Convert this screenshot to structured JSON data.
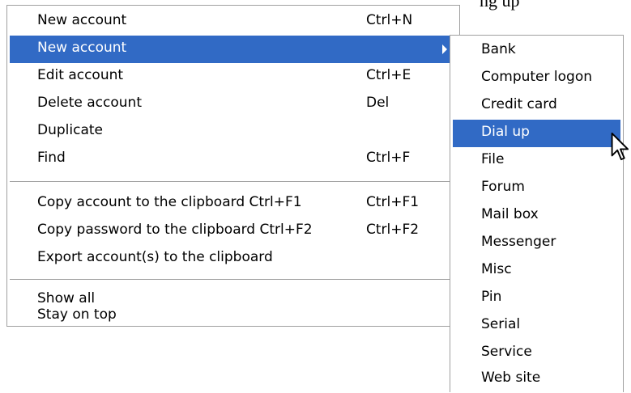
{
  "background_text": "ng up",
  "main_menu": {
    "items": [
      {
        "label": "New account",
        "shortcut": "Ctrl+N"
      },
      {
        "label": "New account",
        "shortcut": "",
        "submenu": true,
        "highlighted": true
      },
      {
        "label": "Edit account",
        "shortcut": "Ctrl+E"
      },
      {
        "label": "Delete account",
        "shortcut": "Del"
      },
      {
        "label": "Duplicate",
        "shortcut": ""
      },
      {
        "label": "Find",
        "shortcut": "Ctrl+F"
      },
      {
        "label": "Copy account to the clipboard Ctrl+F1",
        "shortcut": "Ctrl+F1"
      },
      {
        "label": "Copy password to the clipboard Ctrl+F2",
        "shortcut": "Ctrl+F2"
      },
      {
        "label": "Export account(s) to the clipboard",
        "shortcut": ""
      },
      {
        "label": "Show all",
        "shortcut": ""
      },
      {
        "label": "Stay on top",
        "shortcut": ""
      }
    ]
  },
  "submenu": {
    "items": [
      "Bank",
      "Computer logon",
      "Credit card",
      "Dial up",
      "File",
      "Forum",
      "Mail box",
      "Messenger",
      "Misc",
      "Pin",
      "Serial",
      "Service",
      "Web site"
    ],
    "highlighted": "Dial up"
  },
  "colors": {
    "highlight": "#316ac5",
    "border": "#a0a0a0"
  }
}
